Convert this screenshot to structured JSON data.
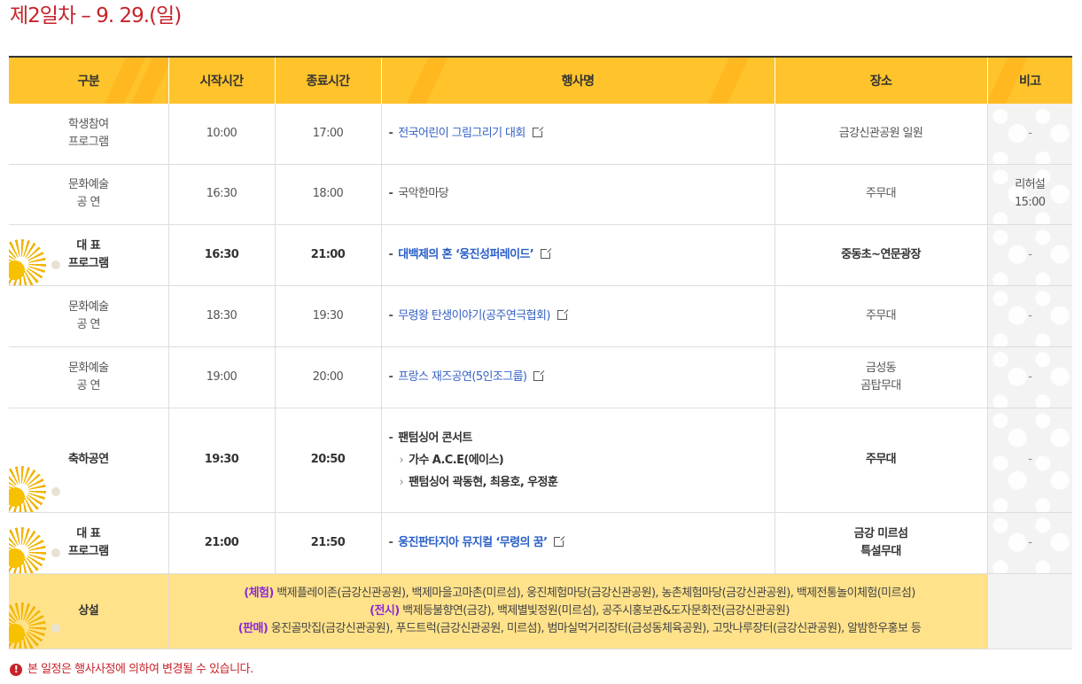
{
  "page_title": "제2일차 – 9. 29.(일)",
  "table": {
    "headers": [
      "구분",
      "시작시간",
      "종료시간",
      "행사명",
      "장소",
      "비고"
    ],
    "rows": [
      {
        "category": [
          "학생참여",
          "프로그램"
        ],
        "start": "10:00",
        "end": "17:00",
        "event": "전국어린이 그림그리기 대회",
        "place": [
          "금강신관공원 일원"
        ],
        "note": [
          "-"
        ]
      },
      {
        "category": [
          "문화예술",
          "공 연"
        ],
        "start": "16:30",
        "end": "18:00",
        "event": "국악한마당",
        "place": [
          "주무대"
        ],
        "note": [
          "리허설",
          "15:00"
        ]
      },
      {
        "category": [
          "대 표",
          "프로그램"
        ],
        "start": "16:30",
        "end": "21:00",
        "event": "대백제의 혼 ‘웅진성퍼레이드’",
        "place": [
          "중동초~연문광장"
        ],
        "note": [
          "-"
        ]
      },
      {
        "category": [
          "문화예술",
          "공 연"
        ],
        "start": "18:30",
        "end": "19:30",
        "event": "무령왕 탄생이야기(공주연극협회)",
        "place": [
          "주무대"
        ],
        "note": [
          "-"
        ]
      },
      {
        "category": [
          "문화예술",
          "공 연"
        ],
        "start": "19:00",
        "end": "20:00",
        "event": "프랑스 재즈공연(5인조그룹)",
        "place": [
          "금성동",
          "곰탑무대"
        ],
        "note": [
          "-"
        ]
      },
      {
        "category": [
          "축하공연"
        ],
        "start": "19:30",
        "end": "20:50",
        "event": "팬텀싱어 콘서트",
        "sub_items": [
          "가수 A.C.E(에이스)",
          "팬텀싱어 곽동현, 최용호, 우정훈"
        ],
        "place": [
          "주무대"
        ],
        "note": [
          "-"
        ]
      },
      {
        "category": [
          "대 표",
          "프로그램"
        ],
        "start": "21:00",
        "end": "21:50",
        "event": "웅진판타지아 뮤지컬 ‘무령의 꿈’",
        "place": [
          "금강 미르섬",
          "특설무대"
        ],
        "note": [
          "-"
        ]
      }
    ],
    "permanent": {
      "category": "상설",
      "lines": [
        {
          "tag": "(체험)",
          "text": "백제플레이존(금강신관공원), 백제마을고마촌(미르섬), 웅진체험마당(금강신관공원), 농촌체험마당(금강신관공원), 백제전통놀이체험(미르섬)"
        },
        {
          "tag": "(전시)",
          "text": "백제등불향연(금강), 백제별빛정원(미르섬), 공주시홍보관&도자문화전(금강신관공원)"
        },
        {
          "tag": "(판매)",
          "text": "웅진골맛집(금강신관공원), 푸드트럭(금강신관공원, 미르섬), 범마실먹거리장터(금성동체육공원), 고맛나루장터(금강신관공원), 알밤한우홍보 등"
        }
      ]
    }
  },
  "footnote": "본 일정은 행사사정에 의하여 변경될 수 있습니다.",
  "colors": {
    "header_bg": "#ffc32b",
    "title": "#c7222a",
    "link": "#3561c4",
    "permanent_bg": "#ffe28a",
    "tag": "#8a2bd6"
  },
  "icons": [
    "external-link-icon",
    "warning-icon",
    "sunburst-decoration"
  ]
}
